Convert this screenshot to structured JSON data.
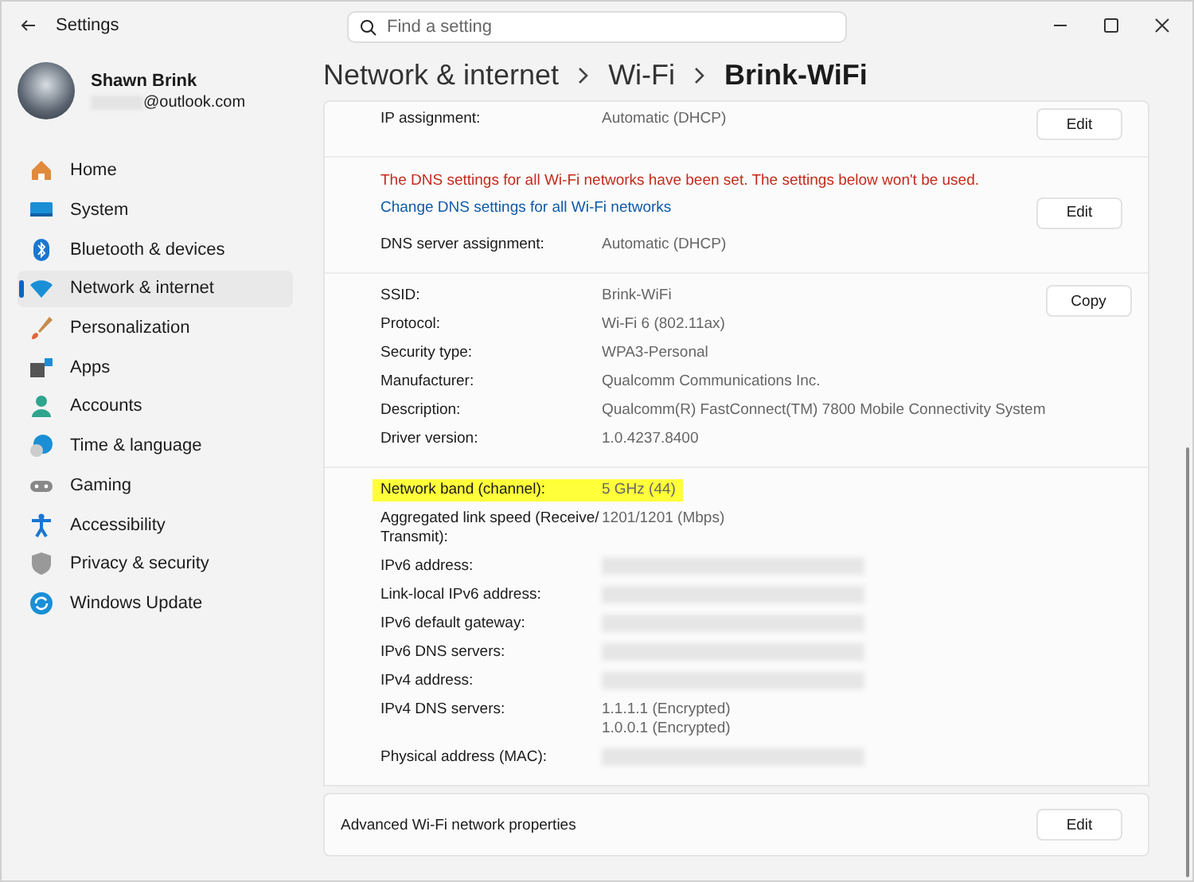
{
  "window": {
    "title": "Settings"
  },
  "search": {
    "placeholder": "Find a setting"
  },
  "user": {
    "name": "Shawn Brink",
    "email": "@outlook.com"
  },
  "sidebar": {
    "items": [
      {
        "label": "Home",
        "selected": false
      },
      {
        "label": "System",
        "selected": false
      },
      {
        "label": "Bluetooth & devices",
        "selected": false
      },
      {
        "label": "Network & internet",
        "selected": true
      },
      {
        "label": "Personalization",
        "selected": false
      },
      {
        "label": "Apps",
        "selected": false
      },
      {
        "label": "Accounts",
        "selected": false
      },
      {
        "label": "Time & language",
        "selected": false
      },
      {
        "label": "Gaming",
        "selected": false
      },
      {
        "label": "Accessibility",
        "selected": false
      },
      {
        "label": "Privacy & security",
        "selected": false
      },
      {
        "label": "Windows Update",
        "selected": false
      }
    ]
  },
  "breadcrumb": [
    "Network & internet",
    "Wi-Fi",
    "Brink-WiFi"
  ],
  "sections": [
    {
      "button": "Edit",
      "rows": [
        {
          "label": "IP assignment:",
          "values": [
            "Automatic (DHCP)"
          ],
          "highlighted": false,
          "redacted": false
        }
      ]
    },
    {
      "button": "Edit",
      "notice": "The DNS settings for all Wi-Fi networks have been set. The settings below won't be used.",
      "link": "Change DNS settings for all Wi-Fi networks",
      "rows": [
        {
          "label": "DNS server assignment:",
          "values": [
            "Automatic (DHCP)"
          ],
          "highlighted": false,
          "redacted": false
        }
      ]
    },
    {
      "button": "Copy",
      "rows": [
        {
          "label": "SSID:",
          "values": [
            "Brink-WiFi"
          ],
          "highlighted": false,
          "redacted": false
        },
        {
          "label": "Protocol:",
          "values": [
            "Wi-Fi 6 (802.11ax)"
          ],
          "highlighted": false,
          "redacted": false
        },
        {
          "label": "Security type:",
          "values": [
            "WPA3-Personal"
          ],
          "highlighted": false,
          "redacted": false
        },
        {
          "label": "Manufacturer:",
          "values": [
            "Qualcomm Communications Inc."
          ],
          "highlighted": false,
          "redacted": false
        },
        {
          "label": "Description:",
          "values": [
            "Qualcomm(R) FastConnect(TM) 7800 Mobile Connectivity System"
          ],
          "highlighted": false,
          "redacted": false
        },
        {
          "label": "Driver version:",
          "values": [
            "1.0.4237.8400"
          ],
          "highlighted": false,
          "redacted": false
        }
      ]
    },
    {
      "rows": [
        {
          "label": "Network band (channel):",
          "values": [
            "5 GHz (44)"
          ],
          "highlighted": true,
          "redacted": false
        },
        {
          "label": "Aggregated link speed (Receive/ Transmit):",
          "values": [
            "1201/1201 (Mbps)"
          ],
          "highlighted": false,
          "redacted": false
        },
        {
          "label": "IPv6 address:",
          "values": [],
          "highlighted": false,
          "redacted": true
        },
        {
          "label": "Link-local IPv6 address:",
          "values": [],
          "highlighted": false,
          "redacted": true
        },
        {
          "label": "IPv6 default gateway:",
          "values": [],
          "highlighted": false,
          "redacted": true
        },
        {
          "label": "IPv6 DNS servers:",
          "values": [],
          "highlighted": false,
          "redacted": true
        },
        {
          "label": "IPv4 address:",
          "values": [],
          "highlighted": false,
          "redacted": true
        },
        {
          "label": "IPv4 DNS servers:",
          "values": [
            "1.1.1.1 (Encrypted)",
            "1.0.0.1 (Encrypted)"
          ],
          "highlighted": false,
          "redacted": false
        },
        {
          "label": "Physical address (MAC):",
          "values": [],
          "highlighted": false,
          "redacted": true
        }
      ]
    }
  ],
  "advanced": {
    "label": "Advanced Wi-Fi network properties",
    "button": "Edit"
  }
}
